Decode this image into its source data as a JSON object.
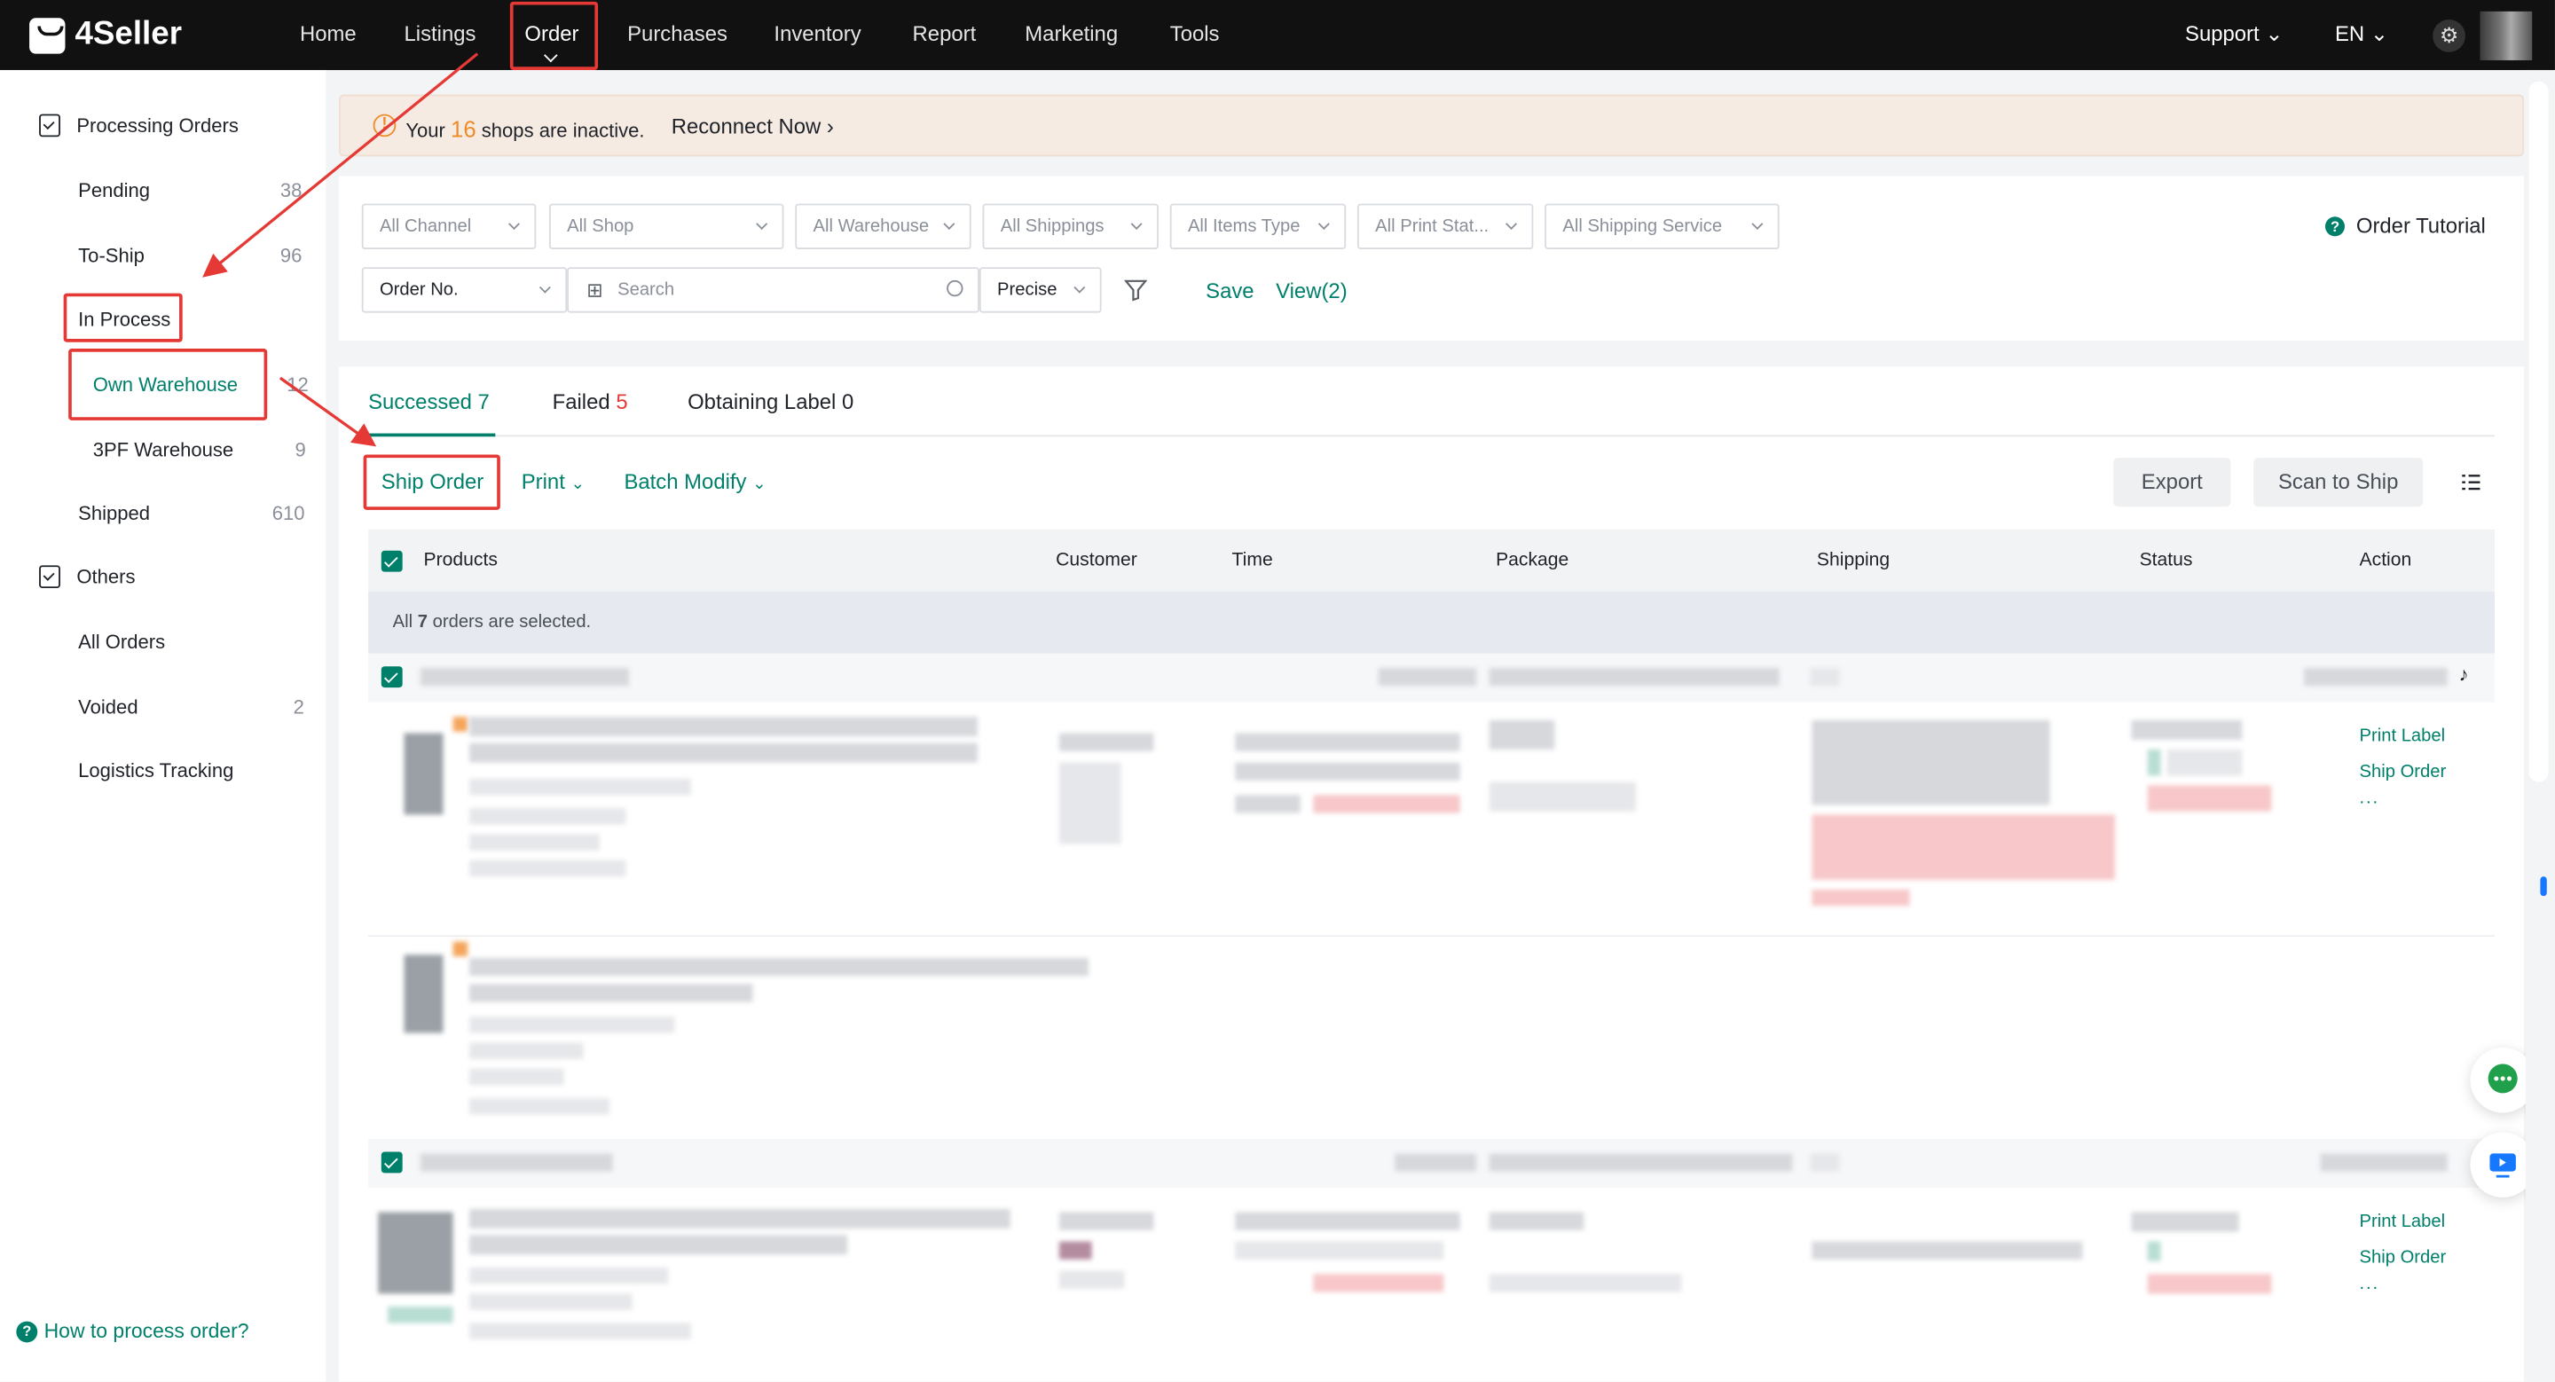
{
  "app": {
    "logo_text": "4Seller"
  },
  "topnav": {
    "items": [
      "Home",
      "Listings",
      "Order",
      "Purchases",
      "Inventory",
      "Report",
      "Marketing",
      "Tools"
    ],
    "active": "Order",
    "support_label": "Support",
    "lang_label": "EN"
  },
  "sidebar": {
    "processing_label": "Processing Orders",
    "pending_label": "Pending",
    "pending_count": "38",
    "toship_label": "To-Ship",
    "toship_count": "96",
    "inprocess_label": "In Process",
    "ownwh_label": "Own Warehouse",
    "ownwh_count": "12",
    "tpf_label": "3PF Warehouse",
    "tpf_count": "9",
    "shipped_label": "Shipped",
    "shipped_count": "610",
    "others_label": "Others",
    "allorders_label": "All Orders",
    "voided_label": "Voided",
    "voided_count": "2",
    "logistics_label": "Logistics Tracking",
    "help_label": "How to process order?"
  },
  "banner": {
    "prefix": "Your",
    "count": "16",
    "suffix": "shops are inactive.",
    "link": "Reconnect Now"
  },
  "filters": {
    "channel": "All Channel",
    "shop": "All Shop",
    "warehouse": "All Warehouse",
    "shippings": "All Shippings",
    "items_type": "All Items Type",
    "print_status": "All Print Stat...",
    "shipping_service": "All Shipping Service",
    "order_tutorial": "Order Tutorial",
    "search_field": "Order No.",
    "search_placeholder": "Search",
    "precise": "Precise",
    "save": "Save",
    "view": "View(2)"
  },
  "tabs": {
    "successed_label": "Successed",
    "successed_count": "7",
    "failed_label": "Failed",
    "failed_count": "5",
    "obtaining_label": "Obtaining Label 0"
  },
  "toolbar": {
    "ship_order": "Ship Order",
    "print": "Print",
    "batch_modify": "Batch Modify",
    "export": "Export",
    "scan_to_ship": "Scan to Ship"
  },
  "table": {
    "columns": [
      "Products",
      "Customer",
      "Time",
      "Package",
      "Shipping",
      "Status",
      "Action"
    ],
    "selection_prefix": "All",
    "selection_count": "7",
    "selection_suffix": "orders are selected.",
    "actions": {
      "print_label": "Print Label",
      "ship_order": "Ship Order",
      "more": "..."
    }
  },
  "colors": {
    "accent": "#00806b",
    "warning": "#f08c28",
    "highlight_box": "#e53935",
    "failed": "#e53935"
  }
}
